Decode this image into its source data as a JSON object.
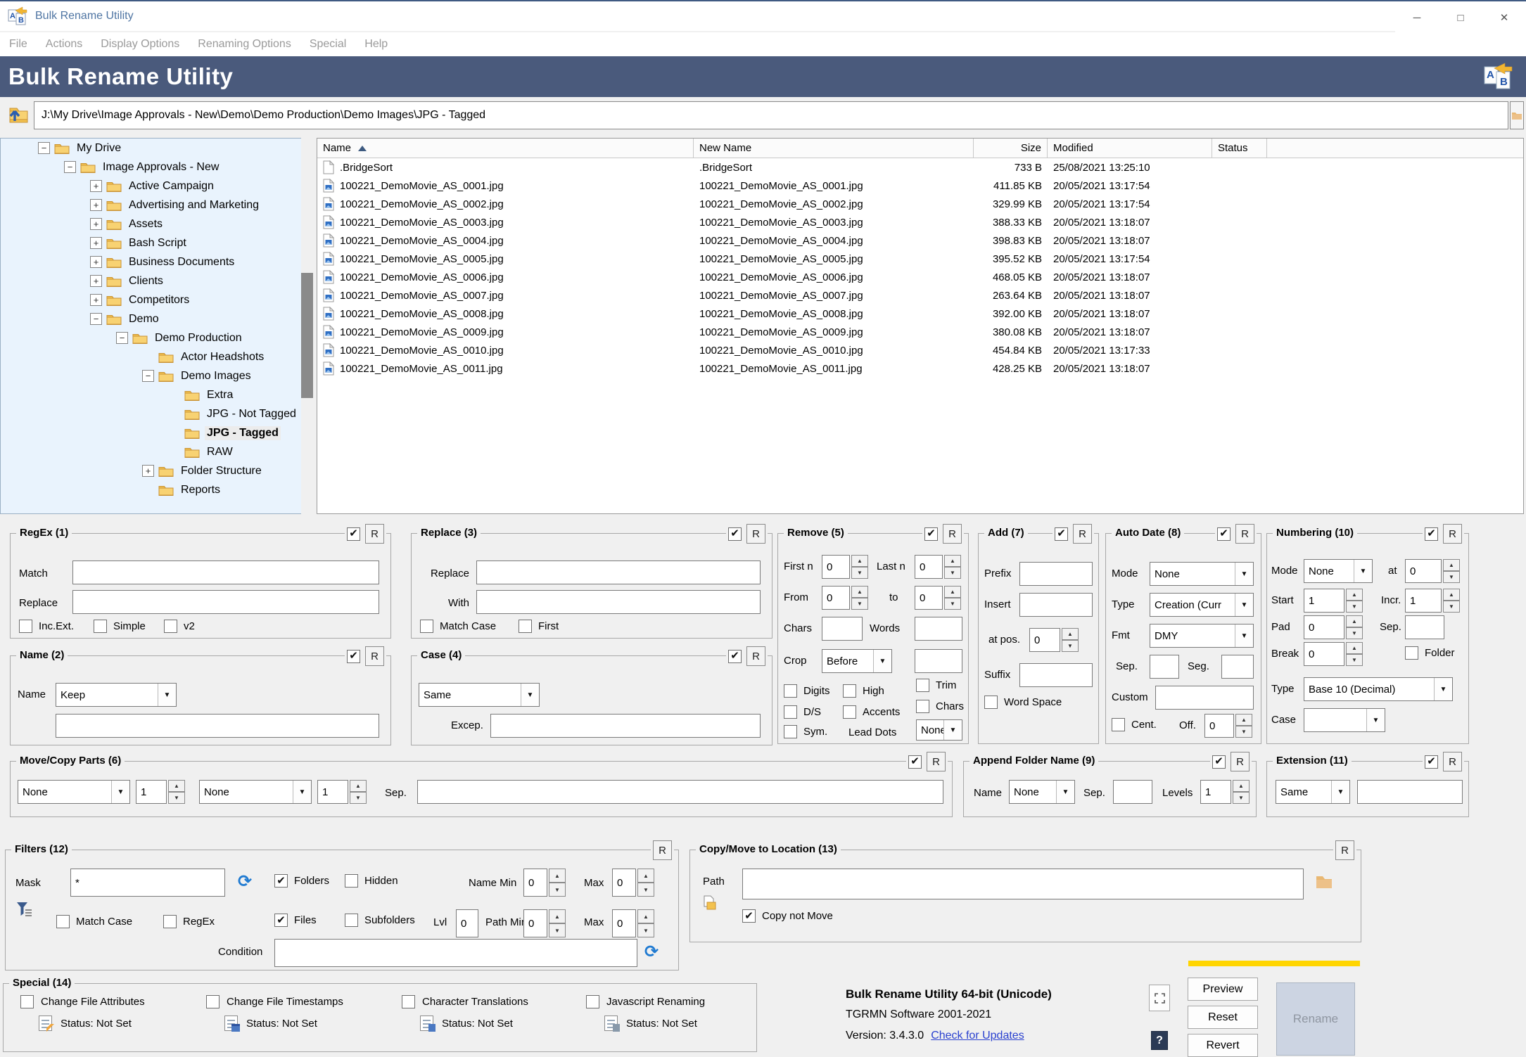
{
  "common": {
    "r_button": "R"
  },
  "window": {
    "title": "Bulk Rename Utility",
    "minimize_glyph": "─",
    "maximize_glyph": "□",
    "close_glyph": "✕"
  },
  "menu": {
    "items": [
      "File",
      "Actions",
      "Display Options",
      "Renaming Options",
      "Special",
      "Help"
    ]
  },
  "header": {
    "title": "Bulk Rename Utility"
  },
  "address": {
    "path": "J:\\My Drive\\Image Approvals - New\\Demo\\Demo Production\\Demo Images\\JPG - Tagged"
  },
  "tree": {
    "items": [
      {
        "depth": 1,
        "expander": "minus",
        "label": "My Drive"
      },
      {
        "depth": 2,
        "expander": "minus",
        "label": "Image Approvals - New"
      },
      {
        "depth": 3,
        "expander": "plus",
        "label": "Active Campaign"
      },
      {
        "depth": 3,
        "expander": "plus",
        "label": "Advertising and Marketing"
      },
      {
        "depth": 3,
        "expander": "plus",
        "label": "Assets"
      },
      {
        "depth": 3,
        "expander": "plus",
        "label": "Bash Script"
      },
      {
        "depth": 3,
        "expander": "plus",
        "label": "Business Documents"
      },
      {
        "depth": 3,
        "expander": "plus",
        "label": "Clients"
      },
      {
        "depth": 3,
        "expander": "plus",
        "label": "Competitors"
      },
      {
        "depth": 3,
        "expander": "minus",
        "label": "Demo"
      },
      {
        "depth": 4,
        "expander": "minus",
        "label": "Demo Production"
      },
      {
        "depth": 5,
        "expander": "none",
        "label": "Actor Headshots"
      },
      {
        "depth": 5,
        "expander": "minus",
        "label": "Demo Images"
      },
      {
        "depth": 6,
        "expander": "none",
        "label": "Extra"
      },
      {
        "depth": 6,
        "expander": "none",
        "label": "JPG - Not Tagged"
      },
      {
        "depth": 6,
        "expander": "none",
        "label": "JPG - Tagged",
        "selected": true
      },
      {
        "depth": 6,
        "expander": "none",
        "label": "RAW"
      },
      {
        "depth": 5,
        "expander": "plus",
        "label": "Folder Structure"
      },
      {
        "depth": 5,
        "expander": "none",
        "label": "Reports"
      }
    ]
  },
  "filelist": {
    "columns": {
      "name": "Name",
      "new_name": "New Name",
      "size": "Size",
      "modified": "Modified",
      "status": "Status"
    },
    "rows": [
      {
        "icon": "file",
        "name": ".BridgeSort",
        "new_name": ".BridgeSort",
        "size": "733 B",
        "modified": "25/08/2021 13:25:10",
        "status": ""
      },
      {
        "icon": "image",
        "name": "100221_DemoMovie_AS_0001.jpg",
        "new_name": "100221_DemoMovie_AS_0001.jpg",
        "size": "411.85 KB",
        "modified": "20/05/2021 13:17:54",
        "status": ""
      },
      {
        "icon": "image",
        "name": "100221_DemoMovie_AS_0002.jpg",
        "new_name": "100221_DemoMovie_AS_0002.jpg",
        "size": "329.99 KB",
        "modified": "20/05/2021 13:17:54",
        "status": ""
      },
      {
        "icon": "image",
        "name": "100221_DemoMovie_AS_0003.jpg",
        "new_name": "100221_DemoMovie_AS_0003.jpg",
        "size": "388.33 KB",
        "modified": "20/05/2021 13:18:07",
        "status": ""
      },
      {
        "icon": "image",
        "name": "100221_DemoMovie_AS_0004.jpg",
        "new_name": "100221_DemoMovie_AS_0004.jpg",
        "size": "398.83 KB",
        "modified": "20/05/2021 13:18:07",
        "status": ""
      },
      {
        "icon": "image",
        "name": "100221_DemoMovie_AS_0005.jpg",
        "new_name": "100221_DemoMovie_AS_0005.jpg",
        "size": "395.52 KB",
        "modified": "20/05/2021 13:17:54",
        "status": ""
      },
      {
        "icon": "image",
        "name": "100221_DemoMovie_AS_0006.jpg",
        "new_name": "100221_DemoMovie_AS_0006.jpg",
        "size": "468.05 KB",
        "modified": "20/05/2021 13:18:07",
        "status": ""
      },
      {
        "icon": "image",
        "name": "100221_DemoMovie_AS_0007.jpg",
        "new_name": "100221_DemoMovie_AS_0007.jpg",
        "size": "263.64 KB",
        "modified": "20/05/2021 13:18:07",
        "status": ""
      },
      {
        "icon": "image",
        "name": "100221_DemoMovie_AS_0008.jpg",
        "new_name": "100221_DemoMovie_AS_0008.jpg",
        "size": "392.00 KB",
        "modified": "20/05/2021 13:18:07",
        "status": ""
      },
      {
        "icon": "image",
        "name": "100221_DemoMovie_AS_0009.jpg",
        "new_name": "100221_DemoMovie_AS_0009.jpg",
        "size": "380.08 KB",
        "modified": "20/05/2021 13:18:07",
        "status": ""
      },
      {
        "icon": "image",
        "name": "100221_DemoMovie_AS_0010.jpg",
        "new_name": "100221_DemoMovie_AS_0010.jpg",
        "size": "454.84 KB",
        "modified": "20/05/2021 13:17:33",
        "status": ""
      },
      {
        "icon": "image",
        "name": "100221_DemoMovie_AS_0011.jpg",
        "new_name": "100221_DemoMovie_AS_0011.jpg",
        "size": "428.25 KB",
        "modified": "20/05/2021 13:18:07",
        "status": ""
      }
    ]
  },
  "panels": {
    "regex": {
      "title": "RegEx (1)",
      "match_label": "Match",
      "match_value": "",
      "replace_label": "Replace",
      "replace_value": "",
      "inc_ext_label": "Inc.Ext.",
      "simple_label": "Simple",
      "v2_label": "v2"
    },
    "name": {
      "title": "Name (2)",
      "name_label": "Name",
      "mode": "Keep",
      "value": ""
    },
    "replace": {
      "title": "Replace (3)",
      "replace_label": "Replace",
      "replace_value": "",
      "with_label": "With",
      "with_value": "",
      "match_case_label": "Match Case",
      "first_label": "First"
    },
    "case": {
      "title": "Case (4)",
      "mode": "Same",
      "excep_label": "Excep.",
      "excep_value": ""
    },
    "remove": {
      "title": "Remove (5)",
      "first_n_label": "First n",
      "first_n": "0",
      "last_n_label": "Last n",
      "last_n": "0",
      "from_label": "From",
      "from": "0",
      "to_label": "to",
      "to": "0",
      "chars_label": "Chars",
      "chars_value": "",
      "words_label": "Words",
      "words_value": "",
      "crop_label": "Crop",
      "crop_mode": "Before",
      "crop_value": "",
      "digits_label": "Digits",
      "high_label": "High",
      "trim_label": "Trim",
      "ds_label": "D/S",
      "accents_label": "Accents",
      "chars_cb_label": "Chars",
      "sym_label": "Sym.",
      "lead_dots_label": "Lead Dots",
      "lead_dots_mode": "None"
    },
    "movecopy": {
      "title": "Move/Copy Parts (6)",
      "mode1": "None",
      "count1": "1",
      "mode2": "None",
      "count2": "1",
      "sep_label": "Sep.",
      "sep_value": ""
    },
    "add": {
      "title": "Add (7)",
      "prefix_label": "Prefix",
      "prefix_value": "",
      "insert_label": "Insert",
      "insert_value": "",
      "at_pos_label": "at pos.",
      "at_pos": "0",
      "suffix_label": "Suffix",
      "suffix_value": "",
      "word_space_label": "Word Space"
    },
    "autodate": {
      "title": "Auto Date (8)",
      "mode_label": "Mode",
      "mode": "None",
      "type_label": "Type",
      "type": "Creation (Curr",
      "fmt_label": "Fmt",
      "fmt": "DMY",
      "sep_label": "Sep.",
      "sep_value": "",
      "seg_label": "Seg.",
      "seg_value": "",
      "custom_label": "Custom",
      "custom_value": "",
      "cent_label": "Cent.",
      "off_label": "Off.",
      "off": "0"
    },
    "appendfolder": {
      "title": "Append Folder Name (9)",
      "name_label": "Name",
      "mode": "None",
      "sep_label": "Sep.",
      "sep_value": "",
      "levels_label": "Levels",
      "levels": "1"
    },
    "numbering": {
      "title": "Numbering (10)",
      "mode_label": "Mode",
      "mode": "None",
      "at_label": "at",
      "at": "0",
      "start_label": "Start",
      "start": "1",
      "incr_label": "Incr.",
      "incr": "1",
      "pad_label": "Pad",
      "pad": "0",
      "sep_label": "Sep.",
      "sep_value": "",
      "break_label": "Break",
      "break": "0",
      "folder_label": "Folder",
      "type_label": "Type",
      "type": "Base 10 (Decimal)",
      "case_label": "Case",
      "case": ""
    },
    "extension": {
      "title": "Extension (11)",
      "mode": "Same",
      "value": ""
    },
    "filters": {
      "title": "Filters (12)",
      "mask_label": "Mask",
      "mask": "*",
      "match_case_label": "Match Case",
      "regex_label": "RegEx",
      "folders_label": "Folders",
      "hidden_label": "Hidden",
      "files_label": "Files",
      "subfolders_label": "Subfolders",
      "lvl_label": "Lvl",
      "lvl": "0",
      "name_min_label": "Name Min",
      "name_min": "0",
      "name_max_label": "Max",
      "name_max": "0",
      "path_min_label": "Path Min",
      "path_min": "0",
      "path_max_label": "Max",
      "path_max": "0",
      "condition_label": "Condition",
      "condition": ""
    },
    "copymove": {
      "title": "Copy/Move to Location (13)",
      "path_label": "Path",
      "path": "",
      "copy_not_move_label": "Copy not Move"
    },
    "special": {
      "title": "Special (14)",
      "items": [
        {
          "label": "Change File Attributes",
          "status": "Status: Not Set"
        },
        {
          "label": "Change File Timestamps",
          "status": "Status: Not Set"
        },
        {
          "label": "Character Translations",
          "status": "Status: Not Set"
        },
        {
          "label": "Javascript Renaming",
          "status": "Status: Not Set"
        }
      ]
    }
  },
  "footer": {
    "app_name": "Bulk Rename Utility 64-bit (Unicode)",
    "company": "TGRMN Software 2001-2021",
    "version": "Version: 3.4.3.0",
    "update_link": "Check for Updates",
    "preview": "Preview",
    "reset": "Reset",
    "revert": "Revert",
    "rename": "Rename",
    "help_glyph": "?"
  },
  "colors": {
    "header_bg": "#4a5a7c",
    "accent_yellow": "#ffd500",
    "link_blue": "#2a41cf",
    "tree_bg": "#e9f3fd",
    "refresh_blue": "#1f7ad1"
  }
}
